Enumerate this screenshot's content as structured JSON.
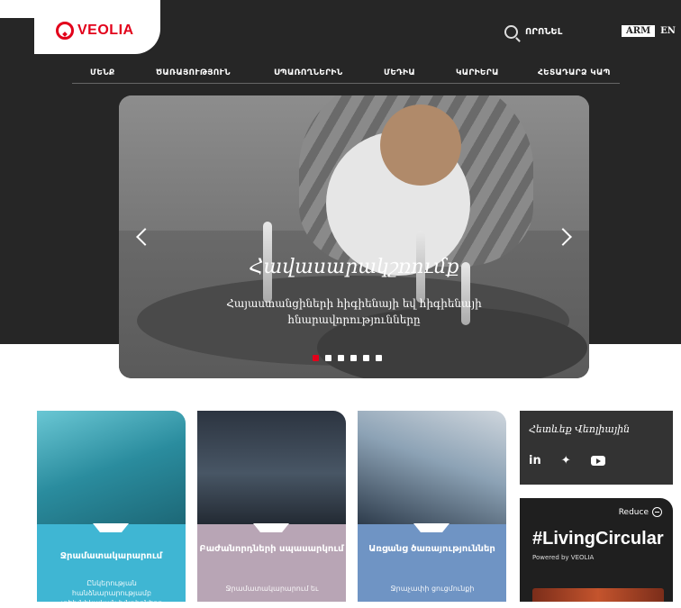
{
  "header": {
    "logo_text": "VEOLIA",
    "search_label": "ՈՐՈՆԵԼ",
    "languages": [
      "ARM",
      "EN"
    ]
  },
  "nav": {
    "items": [
      {
        "label": "ՄԵՆՔ"
      },
      {
        "label": "ԾԱՌԱՅՈՒԹՅՈՒՆ"
      },
      {
        "label": "ՍՊԱՌՈՂՆԵՐԻՆ"
      },
      {
        "label": "ՄԵԴԻԱ"
      },
      {
        "label": "ԿԱՐԻԵՐԱ"
      },
      {
        "label": "ՀԵՏԱԴԱՐՁ ԿԱՊ"
      }
    ]
  },
  "hero": {
    "title": "Հավասարակշռումք",
    "subtitle": "Հայաստանցիների հիգիենայի եվ հիգիենայի հնարավորությունները",
    "slide_count": 6,
    "active_slide": 1
  },
  "cards": [
    {
      "title": "Ջրամատակարարում",
      "desc": "Ընկերության հանձնարարությամբ տեխնիկական խնդիրները",
      "color": "#3fb6d3"
    },
    {
      "title": "Բաժանորդների սպասարկում",
      "desc": "Ջրամատակարարում եւ",
      "color": "#b8a5b5"
    },
    {
      "title": "Առցանց ծառայություններ",
      "desc": "Ջրաչափի ցուցմունքի",
      "color": "#6f94c4"
    }
  ],
  "social": {
    "title": "Հետևեք Վեոլիային",
    "icons": [
      "linkedin-icon",
      "twitter-icon",
      "youtube-icon"
    ]
  },
  "living_circular": {
    "reduce_label": "Reduce",
    "hashtag": "#LivingCircular",
    "powered_by": "Powered by VEOLIA"
  }
}
